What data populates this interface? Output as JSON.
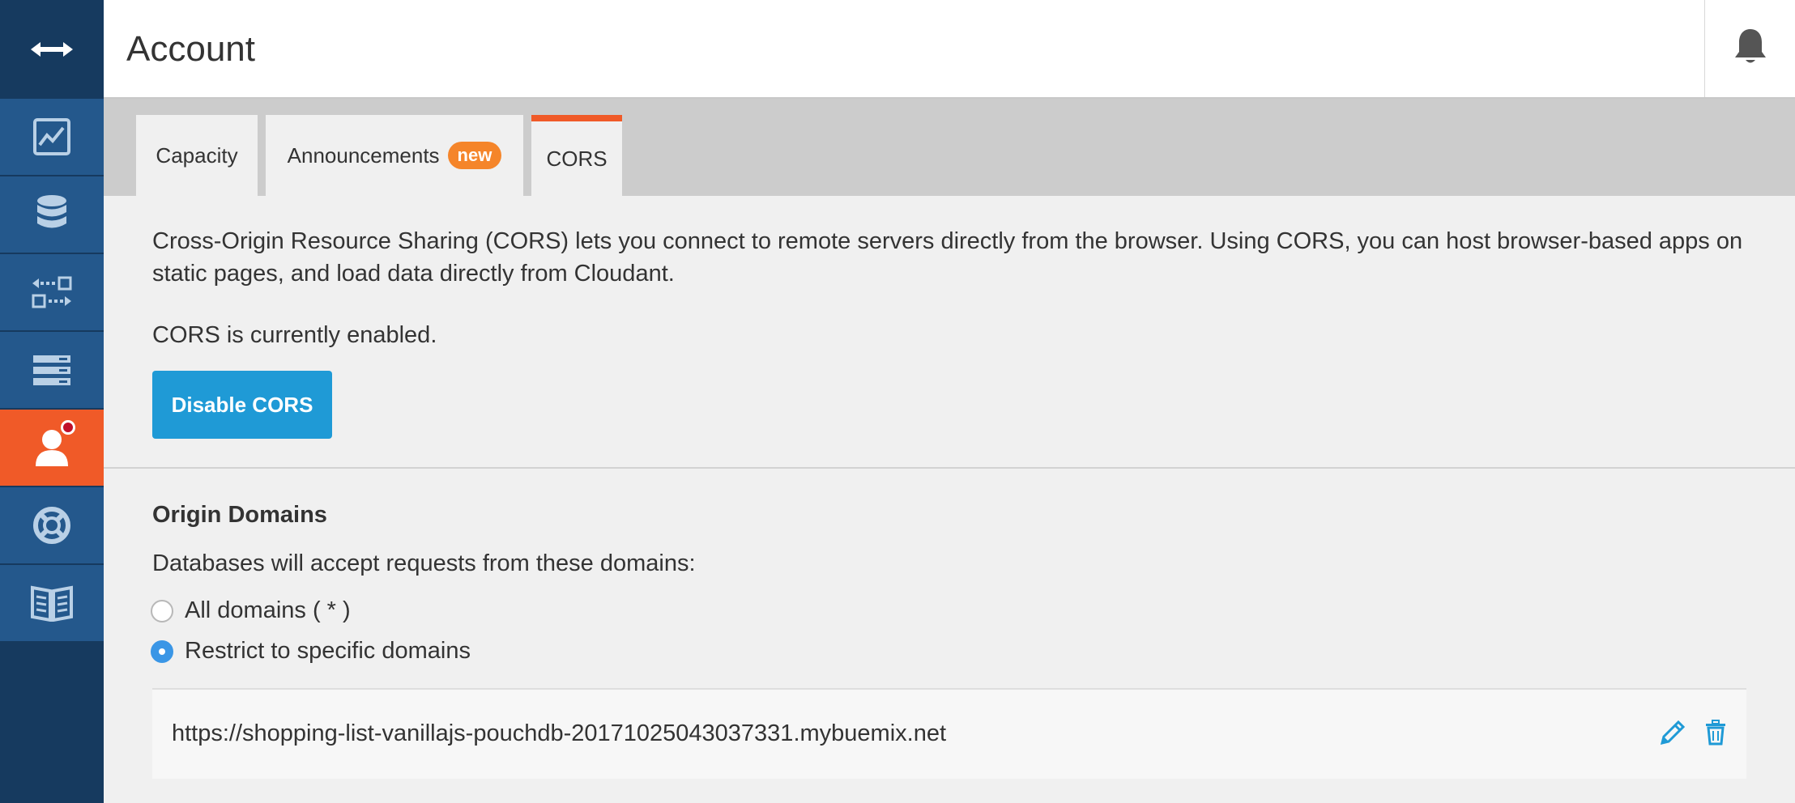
{
  "header": {
    "title": "Account"
  },
  "tabs": [
    {
      "label": "Capacity",
      "active": false
    },
    {
      "label": "Announcements",
      "badge": "new",
      "active": false
    },
    {
      "label": "CORS",
      "active": true
    }
  ],
  "cors": {
    "description": "Cross-Origin Resource Sharing (CORS) lets you connect to remote servers directly from the browser. Using CORS, you can host browser-based apps on static pages, and load data directly from Cloudant.",
    "status": "CORS is currently enabled.",
    "disable_button": "Disable CORS"
  },
  "origins": {
    "title": "Origin Domains",
    "description": "Databases will accept requests from these domains:",
    "options": [
      {
        "label": "All domains ( * )",
        "selected": false
      },
      {
        "label": "Restrict to specific domains",
        "selected": true
      }
    ],
    "domains": [
      "https://shopping-list-vanillajs-pouchdb-20171025043037331.mybuemix.net"
    ]
  },
  "sidebar": {
    "items": [
      {
        "icon": "collapse-arrows-icon"
      },
      {
        "icon": "monitoring-chart-icon"
      },
      {
        "icon": "database-icon"
      },
      {
        "icon": "replication-icon"
      },
      {
        "icon": "active-tasks-icon"
      },
      {
        "icon": "account-user-icon",
        "active": true,
        "notification": true
      },
      {
        "icon": "support-lifebuoy-icon"
      },
      {
        "icon": "documentation-book-icon"
      }
    ]
  },
  "colors": {
    "sidebar_dark": "#163a5f",
    "sidebar_item": "#24588c",
    "accent_orange": "#f05a28",
    "primary_blue": "#1f9ad6",
    "badge_orange": "#f5852a",
    "radio_blue": "#3a96e6"
  }
}
